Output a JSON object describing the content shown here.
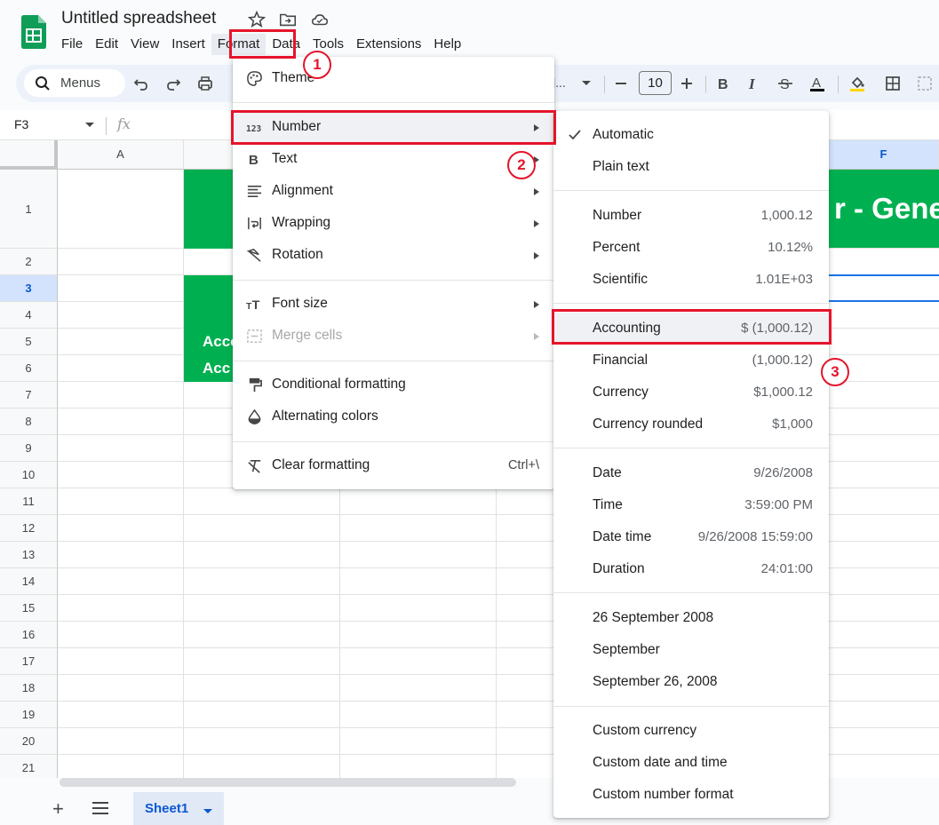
{
  "app": {
    "doc_title": "Untitled spreadsheet",
    "brand_color": "#0f9d58"
  },
  "menubar": [
    "File",
    "Edit",
    "View",
    "Insert",
    "Format",
    "Data",
    "Tools",
    "Extensions",
    "Help"
  ],
  "toolbar": {
    "search_label": "Menus",
    "font_dropdown_text": "l...",
    "font_size": "10"
  },
  "formula_bar": {
    "name_box": "F3",
    "fx_label": "fx"
  },
  "grid": {
    "column_headers": [
      "A",
      "F"
    ],
    "selected_column": "F",
    "row_headers": [
      "1",
      "2",
      "3",
      "4",
      "5",
      "6",
      "7",
      "8",
      "9",
      "10",
      "11",
      "12",
      "13",
      "14",
      "15",
      "16",
      "17",
      "18",
      "19",
      "20",
      "21"
    ],
    "selected_row": "3",
    "cell_b5_text": "Acco",
    "cell_b6_text": "Acc",
    "cell_f1_text": "r - Gene",
    "green_fill": "#00b050"
  },
  "sheets": {
    "active_tab": "Sheet1",
    "add_icon": "+"
  },
  "format_menu": {
    "items": [
      {
        "label": "Theme",
        "icon": "palette-icon"
      },
      {
        "label": "Number",
        "icon": "number-123-icon"
      },
      {
        "label": "Text",
        "icon": "bold-b-icon"
      },
      {
        "label": "Alignment",
        "icon": "align-icon"
      },
      {
        "label": "Wrapping",
        "icon": "wrap-icon"
      },
      {
        "label": "Rotation",
        "icon": "rotation-icon"
      },
      {
        "label": "Font size",
        "icon": "font-size-icon"
      },
      {
        "label": "Merge cells",
        "icon": "merge-icon"
      },
      {
        "label": "Conditional formatting",
        "icon": "paint-roller-icon"
      },
      {
        "label": "Alternating colors",
        "icon": "color-drop-icon"
      },
      {
        "label": "Clear formatting",
        "icon": "clear-format-icon"
      }
    ],
    "clear_shortcut": "Ctrl+\\"
  },
  "number_menu": {
    "items": [
      {
        "label": "Automatic",
        "value": ""
      },
      {
        "label": "Plain text",
        "value": ""
      },
      {
        "label": "Number",
        "value": "1,000.12"
      },
      {
        "label": "Percent",
        "value": "10.12%"
      },
      {
        "label": "Scientific",
        "value": "1.01E+03"
      },
      {
        "label": "Accounting",
        "value": "$ (1,000.12)"
      },
      {
        "label": "Financial",
        "value": "(1,000.12)"
      },
      {
        "label": "Currency",
        "value": "$1,000.12"
      },
      {
        "label": "Currency rounded",
        "value": "$1,000"
      },
      {
        "label": "Date",
        "value": "9/26/2008"
      },
      {
        "label": "Time",
        "value": "3:59:00 PM"
      },
      {
        "label": "Date time",
        "value": "9/26/2008 15:59:00"
      },
      {
        "label": "Duration",
        "value": "24:01:00"
      },
      {
        "label": "26 September 2008",
        "value": ""
      },
      {
        "label": "September",
        "value": ""
      },
      {
        "label": "September 26, 2008",
        "value": ""
      },
      {
        "label": "Custom currency",
        "value": ""
      },
      {
        "label": "Custom date and time",
        "value": ""
      },
      {
        "label": "Custom number format",
        "value": ""
      }
    ]
  },
  "annotations": {
    "step1": "1",
    "step2": "2",
    "step3": "3",
    "color": "#e5142b"
  }
}
